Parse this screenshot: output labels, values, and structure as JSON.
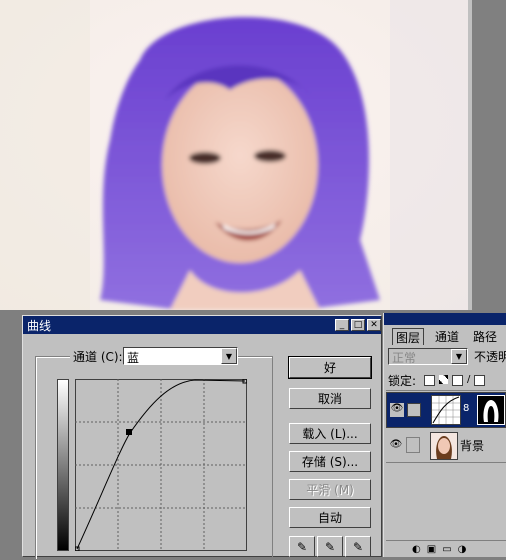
{
  "colors": {
    "accent": "#0a246a",
    "hair": "#7b4bd6",
    "dialog_bg": "#c0c0c0"
  },
  "curves": {
    "title": "曲线",
    "channel_label": "通道 (C):",
    "channel_value": "蓝",
    "buttons": {
      "ok": "好",
      "cancel": "取消",
      "load": "载入 (L)...",
      "save": "存储 (S)...",
      "smooth": "平滑 (M)",
      "auto": "自动"
    }
  },
  "layers": {
    "tabs": [
      "图层",
      "通道",
      "路径"
    ],
    "blend_mode": "正常",
    "opacity_label": "不透明",
    "lock_label": "锁定:",
    "background_layer": "背景"
  }
}
